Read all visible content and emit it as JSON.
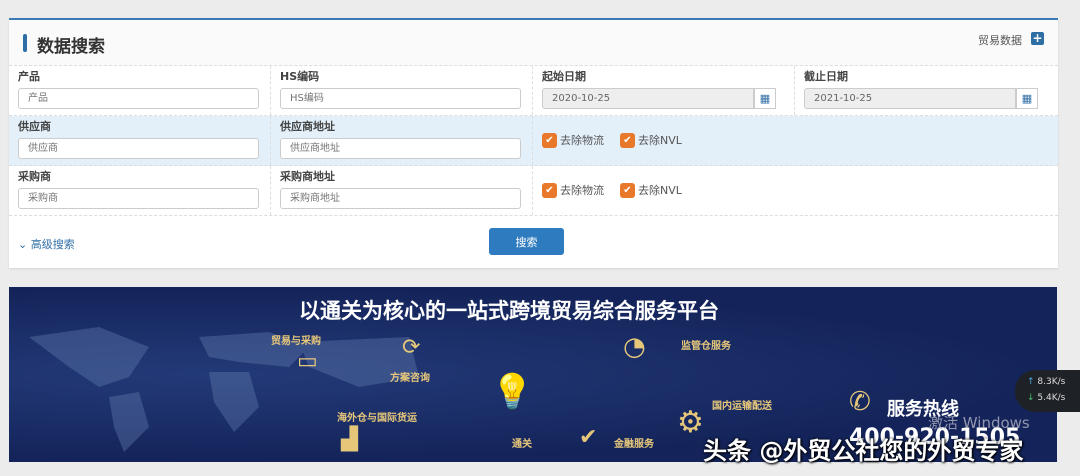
{
  "header": {
    "title": "数据搜索",
    "trade_link": "贸易数据"
  },
  "rows": [
    {
      "fields": [
        {
          "label": "产品",
          "placeholder": "产品"
        },
        {
          "label": "HS编码",
          "placeholder": "HS编码"
        }
      ],
      "dates": [
        {
          "label": "起始日期",
          "value": "2020-10-25"
        },
        {
          "label": "截止日期",
          "value": "2021-10-25"
        }
      ]
    },
    {
      "fields": [
        {
          "label": "供应商",
          "placeholder": "供应商"
        },
        {
          "label": "供应商地址",
          "placeholder": "供应商地址"
        }
      ],
      "checks": [
        "去除物流",
        "去除NVL"
      ]
    },
    {
      "fields": [
        {
          "label": "采购商",
          "placeholder": "采购商"
        },
        {
          "label": "采购商地址",
          "placeholder": "采购商地址"
        }
      ],
      "checks": [
        "去除物流",
        "去除NVL"
      ]
    }
  ],
  "footer": {
    "advanced": "高级搜索",
    "search": "搜索"
  },
  "banner": {
    "title": "以通关为核心的一站式跨境贸易综合服务平台",
    "labels": [
      "贸易与采购",
      "方案咨询",
      "海外仓与国际货运",
      "通关",
      "监管仓服务",
      "国内运输配送",
      "金融服务"
    ],
    "hotline_label": "服务热线",
    "hotline": "400-920-1505"
  },
  "overlay": {
    "upload": "8.3K/s",
    "download": "5.4K/s",
    "windows": "激活 Windows",
    "watermark": "头条 @外贸公社您的外贸专家"
  }
}
